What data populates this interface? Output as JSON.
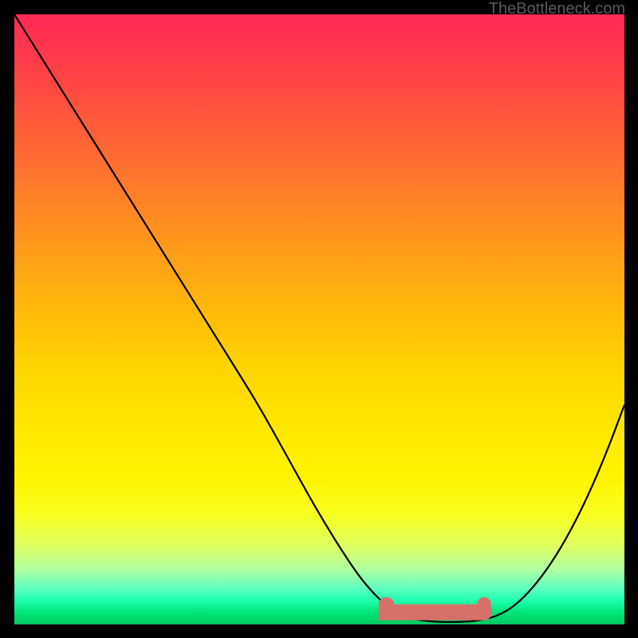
{
  "watermark": "TheBottleneck.com",
  "chart_data": {
    "type": "line",
    "title": "",
    "xlabel": "",
    "ylabel": "",
    "xlim": [
      0,
      100
    ],
    "ylim": [
      0,
      100
    ],
    "grid": false,
    "series": [
      {
        "name": "curve",
        "color": "#000000",
        "x": [
          0,
          5,
          10,
          15,
          20,
          25,
          30,
          35,
          40,
          45,
          50,
          55,
          58,
          61,
          64,
          67,
          70,
          73,
          76,
          79,
          82,
          85,
          88,
          91,
          94,
          97,
          100
        ],
        "y": [
          100,
          92,
          84,
          76,
          68,
          60,
          52,
          44,
          36,
          27,
          18,
          10,
          6,
          3,
          1.2,
          0.6,
          0.4,
          0.4,
          0.6,
          1.3,
          3,
          6,
          10,
          15,
          21,
          28,
          36
        ]
      },
      {
        "name": "optimal-band",
        "color": "#d8706a",
        "x": [
          61,
          77
        ],
        "y": [
          2,
          2
        ]
      },
      {
        "name": "marker",
        "color": "#d8706a",
        "x": [
          77
        ],
        "y": [
          2.5
        ]
      }
    ],
    "background_gradient": {
      "orientation": "vertical",
      "stops": [
        {
          "pos": 0,
          "color": "#ff2a55"
        },
        {
          "pos": 50,
          "color": "#ffd000"
        },
        {
          "pos": 80,
          "color": "#faff30"
        },
        {
          "pos": 100,
          "color": "#00d468"
        }
      ]
    }
  }
}
